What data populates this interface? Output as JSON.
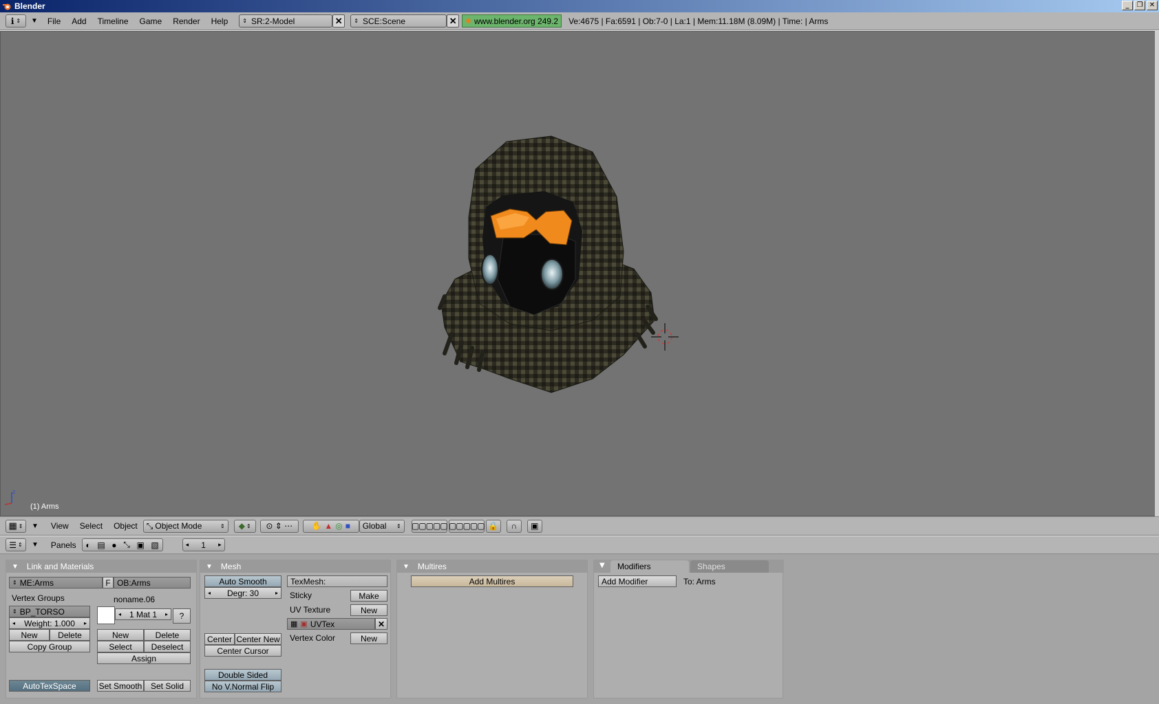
{
  "window": {
    "title": "Blender"
  },
  "menu": {
    "items": [
      "File",
      "Add",
      "Timeline",
      "Game",
      "Render",
      "Help"
    ]
  },
  "screen_field": "SR:2-Model",
  "scene_field": "SCE:Scene",
  "website": "www.blender.org 249.2",
  "stats": "Ve:4675 | Fa:6591 | Ob:7-0 | La:1  | Mem:11.18M (8.09M) | Time: | Arms",
  "viewport": {
    "object_label": "(1) Arms"
  },
  "view_header": {
    "menu": [
      "View",
      "Select",
      "Object"
    ],
    "mode": "Object Mode",
    "orientation": "Global"
  },
  "panels_header": {
    "label": "Panels",
    "frame": "1"
  },
  "link_panel": {
    "title": "Link and Materials",
    "mesh_name": "ME:Arms",
    "f_label": "F",
    "object_name": "OB:Arms",
    "vertex_groups_label": "Vertex Groups",
    "material_name": "noname.06",
    "group_name": "BP_TORSO",
    "weight": "Weight: 1.000",
    "mat_index": "1 Mat 1",
    "help": "?",
    "new": "New",
    "delete": "Delete",
    "copy_group": "Copy Group",
    "mat_new": "New",
    "mat_delete": "Delete",
    "select": "Select",
    "deselect": "Deselect",
    "assign": "Assign",
    "autotexspace": "AutoTexSpace",
    "set_smooth": "Set Smooth",
    "set_solid": "Set Solid"
  },
  "mesh_panel": {
    "title": "Mesh",
    "auto_smooth": "Auto Smooth",
    "degr": "Degr: 30",
    "texmesh": "TexMesh:",
    "sticky": "Sticky",
    "make": "Make",
    "uv_texture": "UV Texture",
    "uv_new": "New",
    "uvtex": "UVTex",
    "vertex_color": "Vertex Color",
    "vc_new": "New",
    "center": "Center",
    "center_new": "Center New",
    "center_cursor": "Center Cursor",
    "double_sided": "Double Sided",
    "no_vnormal_flip": "No V.Normal Flip"
  },
  "multires_panel": {
    "title": "Multires",
    "add": "Add Multires"
  },
  "modifiers_panel": {
    "tab_modifiers": "Modifiers",
    "tab_shapes": "Shapes",
    "add_modifier": "Add Modifier",
    "to": "To: Arms"
  },
  "colors": {
    "viewport_bg": "#737373",
    "header_bg": "#b5b5b5",
    "visor": "#f08a1c"
  }
}
